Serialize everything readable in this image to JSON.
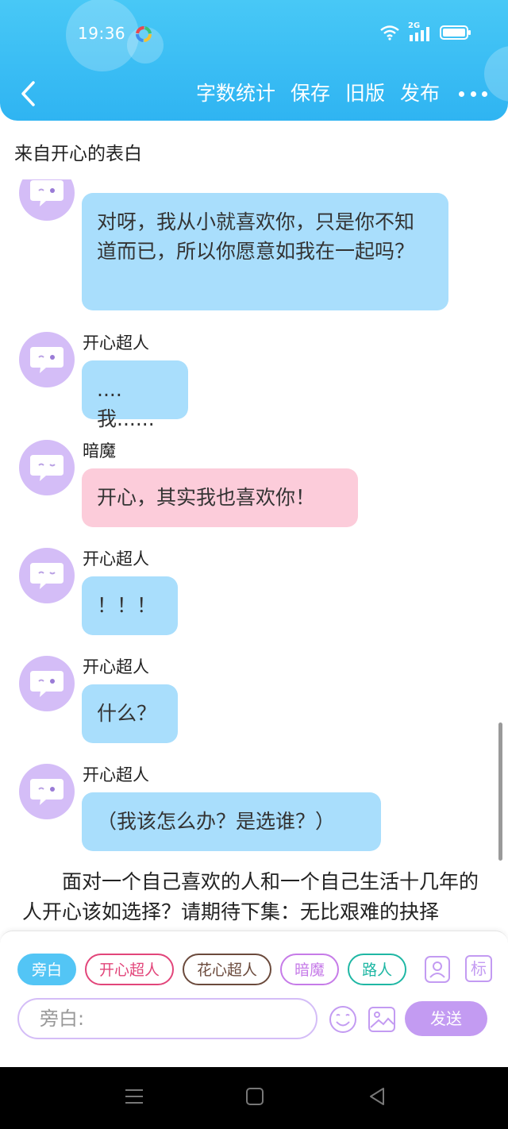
{
  "status_bar": {
    "time": "19:36",
    "network": "2G"
  },
  "header": {
    "actions": [
      "字数统计",
      "保存",
      "旧版",
      "发布"
    ]
  },
  "story_title": "来自开心的表白",
  "messages": [
    {
      "sender": "",
      "text": "对呀，我从小就喜欢你，只是你不知道而已，所以你愿意如我在一起吗？",
      "color": "blue"
    },
    {
      "sender": "开心超人",
      "text": "....我......",
      "color": "blue"
    },
    {
      "sender": "暗魔",
      "text": "开心，其实我也喜欢你！",
      "color": "pink"
    },
    {
      "sender": "开心超人",
      "text": "！！！",
      "color": "blue"
    },
    {
      "sender": "开心超人",
      "text": "什么？",
      "color": "blue"
    },
    {
      "sender": "开心超人",
      "text": "（我该怎么办？是选谁？）",
      "color": "blue"
    }
  ],
  "narration": "面对一个自己喜欢的人和一个自己生活十几年的人开心该如选择？请期待下集：无比艰难的抉择",
  "composer": {
    "roles": [
      {
        "label": "旁白",
        "color": "#53c5f5"
      },
      {
        "label": "开心超人",
        "color": "#e2457a"
      },
      {
        "label": "花心超人",
        "color": "#6b4a3c"
      },
      {
        "label": "暗魔",
        "color": "#c67be8"
      },
      {
        "label": "路人",
        "color": "#1fb7a4"
      }
    ],
    "input_placeholder": "旁白:",
    "send_label": "发送",
    "mark_icon_text": "标"
  },
  "colors": {
    "header": "#2fb4f2",
    "bubble_blue": "#a9defc",
    "bubble_pink": "#fcccda",
    "avatar": "#d4bdf7",
    "send_button": "#c39bf2"
  }
}
